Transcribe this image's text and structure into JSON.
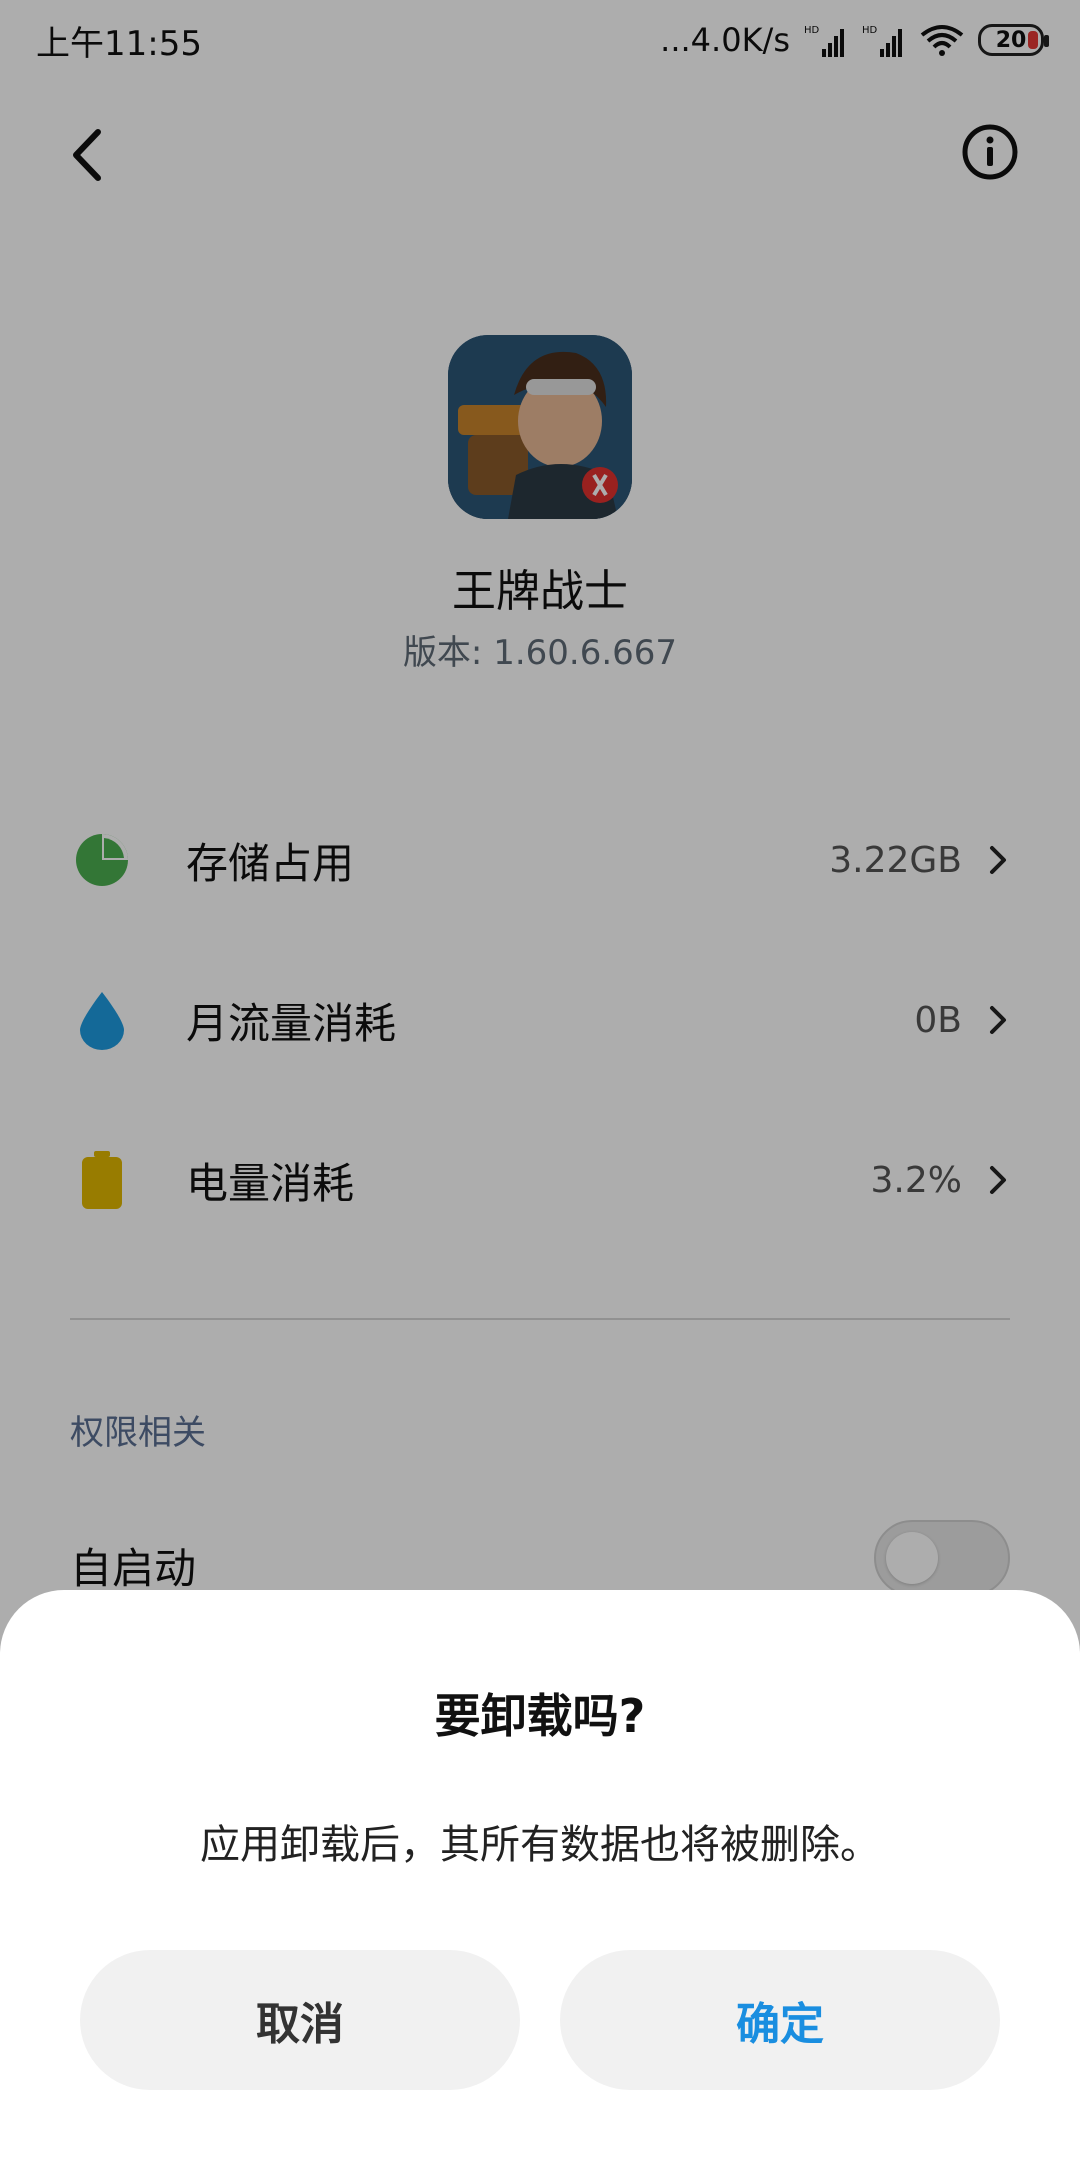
{
  "status_bar": {
    "time": "上午11:55",
    "network_speed": "...4.0K/s",
    "signal_1_label": "HD",
    "signal_2_label": "HD",
    "battery": "20"
  },
  "app": {
    "name": "王牌战士",
    "version": "版本: 1.60.6.667",
    "icon": "app-character-icon"
  },
  "usage_rows": [
    {
      "label": "存储占用",
      "value": "3.22GB",
      "icon": "pie-chart-icon",
      "color": "#4caf50"
    },
    {
      "label": "月流量消耗",
      "value": "0B",
      "icon": "water-drop-icon",
      "color": "#1e9be0"
    },
    {
      "label": "电量消耗",
      "value": "3.2%",
      "icon": "battery-icon",
      "color": "#e0b700"
    }
  ],
  "permissions": {
    "section_title": "权限相关",
    "autostart_label": "自启动",
    "autostart_enabled": false
  },
  "dialog": {
    "title": "要卸载吗?",
    "message": "应用卸载后，其所有数据也将被删除。",
    "cancel_label": "取消",
    "confirm_label": "确定"
  },
  "colors": {
    "accent": "#1a8ee0",
    "section_title": "#5b6f93"
  }
}
